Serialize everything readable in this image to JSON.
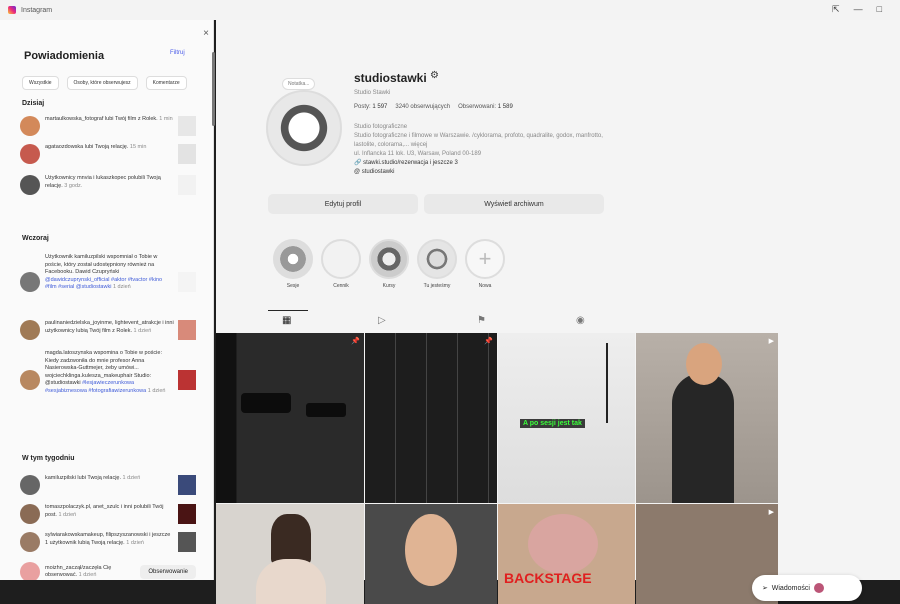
{
  "window": {
    "app_title": "Instagram",
    "controls": [
      "⇱",
      "—",
      "□"
    ]
  },
  "notifications": {
    "title": "Powiadomienia",
    "filter_label": "Filtruj",
    "chips": [
      "Wszystkie",
      "Osoby, które obserwujesz",
      "Komentarze"
    ],
    "sections": {
      "today": "Dzisiaj",
      "yesterday": "Wczoraj",
      "this_week": "W tym tygodniu"
    },
    "today": [
      {
        "text": "martaulkowska_fotograf lubi Twój film z Rolek.",
        "time": "1 min"
      },
      {
        "text": "agataozdowska lubi Twoją relację.",
        "time": "15 min"
      },
      {
        "text": "Użytkownicy mnvia i lukaszkopec polubili Twoją relację.",
        "time": "3 godz."
      }
    ],
    "yesterday": [
      {
        "text": "Użytkownik kamiluzpilski wspomniał o Tobie w poście, który został udostępniony również na Facebooku. Dawid Czupryński",
        "tags": "@dawidczuprynski_official #aktor #tvactor #kino #film #serial @studiostawki",
        "time": "1 dzień"
      },
      {
        "text": "paulinaniedzielska_joyinme, lightevent_atrakcje i inni użytkownicy lubią Twój film z Rolek.",
        "time": "1 dzień"
      },
      {
        "text": "magda.latoszynska wspomina o Tobie w poście: Kiedy zadzwoniła do mnie profesor Anna Nasierowska-Guttmejer, żeby umówi... wojciechklinga.kulesza_makeuphair Studio: @studiostawki",
        "tags": "#lesjawieczerunkowa #sesjabiznesowa #fotografiawizerunkowa",
        "time": "1 dzień"
      }
    ],
    "this_week": [
      {
        "text": "kamiluzpilski lubi Twoją relację.",
        "time": "1 dzień"
      },
      {
        "text": "tomaszpolaczyk.pl, anet_szulc i inni polubili Twój post.",
        "time": "1 dzień"
      },
      {
        "text": "sylwiarakowskamakeup, filipszyszanowski i jeszcze 1 użytkownik lubią Twoją relację.",
        "time": "1 dzień"
      },
      {
        "text": "moizhn_zaczął/zaczęła Cię obserwować.",
        "time": "1 dzień",
        "button": "Obserwowanie"
      }
    ]
  },
  "profile": {
    "username": "studiostawki",
    "note": "Notatka...",
    "full_name": "Studio Stawki",
    "stats": {
      "posts_label": "Posty:",
      "posts": "1 597",
      "followers": "3240 obserwujących",
      "following_label": "Obserwowani:",
      "following": "1 589"
    },
    "category": "Studio fotograficzne",
    "bio": "Studio fotograficzne i filmowe w Warszawie. /cyklorama, profoto, quadralite, godox, manfrotto, lastolite, colorama,... więcej",
    "address": "ul. Inflancka 11 lok. U3, Warsaw, Poland 00-189",
    "link": "stawki.studio/rezerwacja i jeszcze 3",
    "threads": "studiostawki",
    "edit_btn": "Edytuj profil",
    "archive_btn": "Wyświetl archiwum",
    "highlights": [
      "Sesje",
      "Cennik",
      "Kursy",
      "Tu jesteśmy",
      "Nowa"
    ],
    "grid_overlay": "A po sesji jest tak",
    "grid_overlay2": "BACKSTAGE"
  },
  "messages_btn": "Wiadomości",
  "colors": {
    "link": "#3f5bd8",
    "overlay_text": "#3aff3a"
  }
}
